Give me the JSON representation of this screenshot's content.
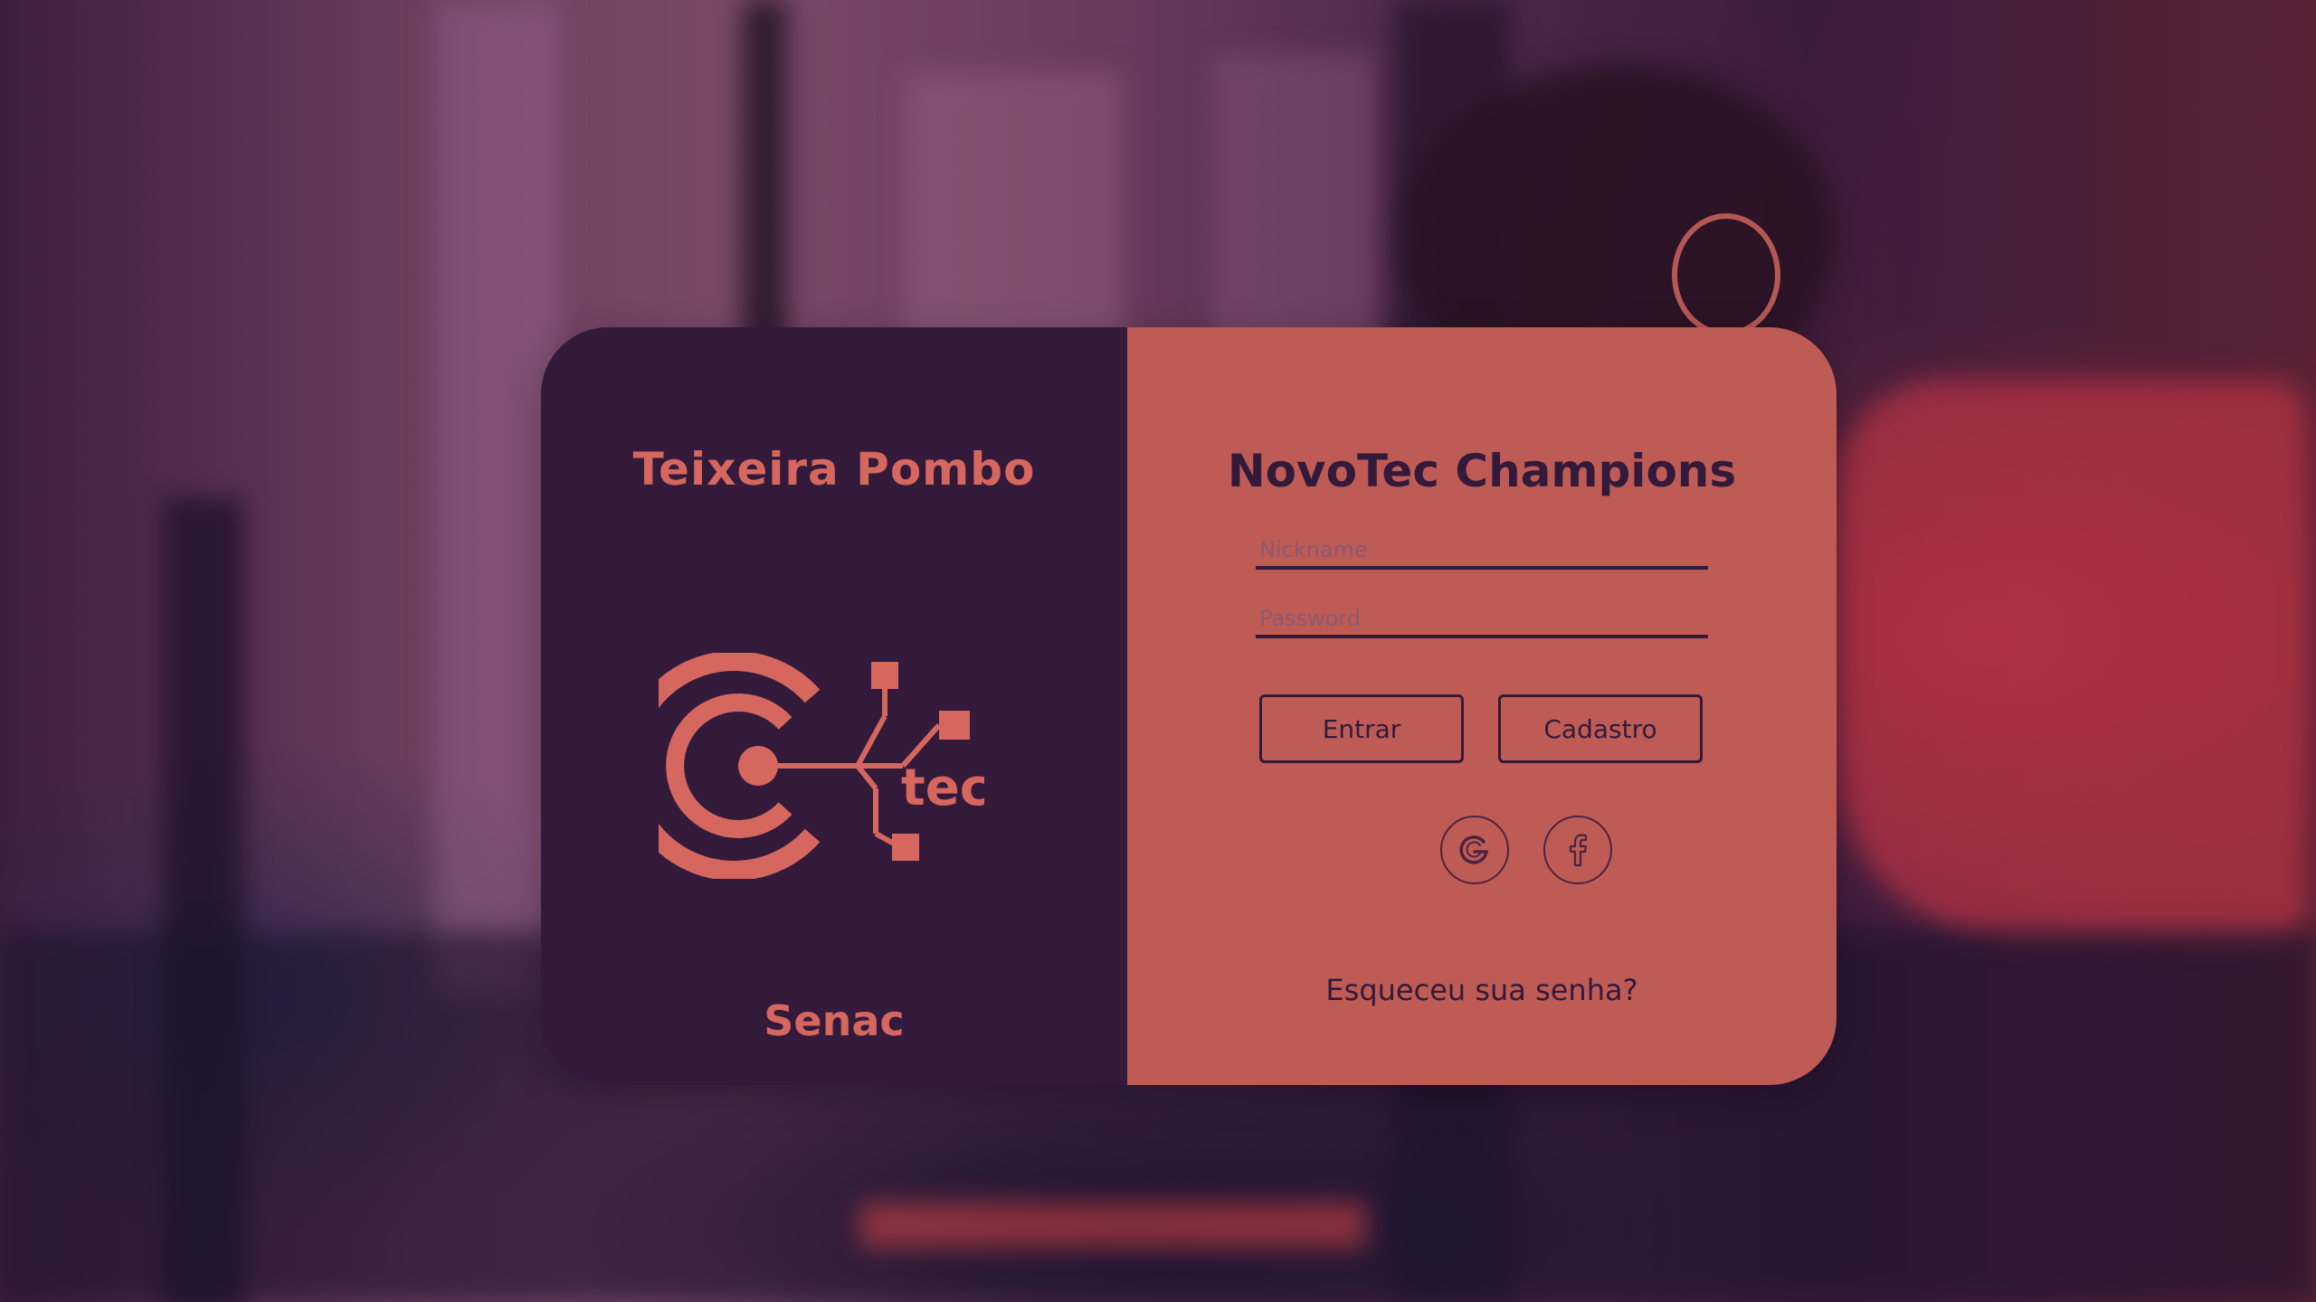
{
  "school": {
    "name": "Teixeira Pombo",
    "footer": "Senac"
  },
  "logo": {
    "text": "tec"
  },
  "login": {
    "title": "NovoTec Champions",
    "nickname_placeholder": "Nickname",
    "password_placeholder": "Password",
    "enter_label": "Entrar",
    "register_label": "Cadastro",
    "forgot_label": "Esqueceu sua senha?"
  },
  "social": {
    "google_icon": "google-icon",
    "facebook_icon": "facebook-icon"
  },
  "colors": {
    "panel_dark": "#331a3b",
    "panel_accent": "#be5b55",
    "logo_accent": "#d5675f"
  }
}
